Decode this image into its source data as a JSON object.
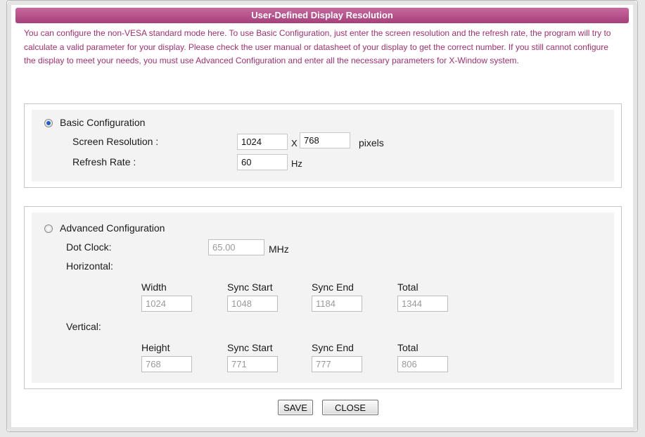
{
  "dialog": {
    "title": "User-Defined Display Resolution",
    "description": "You can configure the non-VESA standard mode here. To use Basic Configuration, just enter the screen resolution and the refresh rate, the program will try to calculate a valid parameter for your display. Please check the user manual or datasheet of your display to get the correct number. If you still cannot configure the display to meet your needs, you must use Advanced Configuration and enter all the necessary parameters for X-Window system."
  },
  "basic": {
    "label": "Basic Configuration",
    "selected": true,
    "resolution_label": "Screen Resolution :",
    "width_value": "1024",
    "x_sep": "X",
    "height_value": "768",
    "pixels_unit": "pixels",
    "refresh_label": "Refresh Rate :",
    "refresh_value": "60",
    "hz_unit": "Hz"
  },
  "advanced": {
    "label": "Advanced Configuration",
    "selected": false,
    "dot_clock_label": "Dot Clock:",
    "dot_clock_value": "65.00",
    "mhz_unit": "MHz",
    "horizontal_label": "Horizontal:",
    "horizontal": {
      "headers": [
        "Width",
        "Sync Start",
        "Sync End",
        "Total"
      ],
      "values": [
        "1024",
        "1048",
        "1184",
        "1344"
      ]
    },
    "vertical_label": "Vertical:",
    "vertical": {
      "headers": [
        "Height",
        "Sync Start",
        "Sync End",
        "Total"
      ],
      "values": [
        "768",
        "771",
        "777",
        "806"
      ]
    }
  },
  "buttons": {
    "save_label": "SAVE",
    "close_label": "CLOSE"
  },
  "colors": {
    "title_bar": "#b04a86",
    "description_text": "#a3306e"
  }
}
